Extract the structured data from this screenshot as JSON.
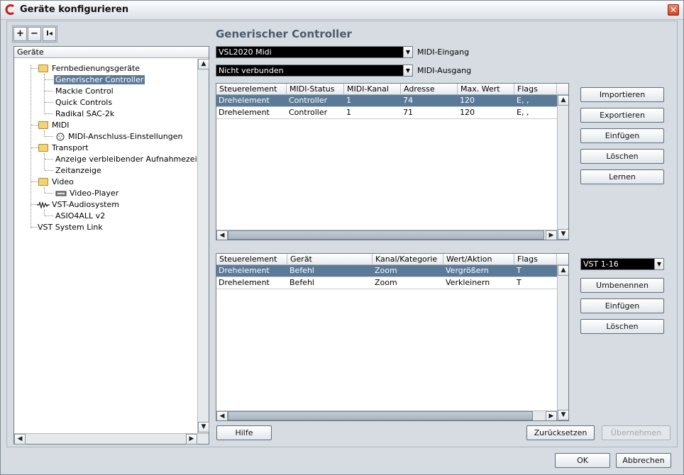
{
  "window": {
    "title": "Geräte konfigurieren",
    "close_label": "✕"
  },
  "toolbar": {
    "add_label": "+",
    "remove_label": "−",
    "reset_label": "I◂"
  },
  "tree": {
    "header": "Geräte",
    "items": [
      {
        "label": "Fernbedienungsgeräte",
        "icon": "folder-icon"
      },
      {
        "label": "Generischer Controller",
        "selected": true
      },
      {
        "label": "Mackie Control"
      },
      {
        "label": "Quick Controls"
      },
      {
        "label": "Radikal SAC-2k"
      },
      {
        "label": "MIDI",
        "icon": "folder-icon"
      },
      {
        "label": "MIDI-Anschluss-Einstellungen",
        "icon": "midi-port-icon"
      },
      {
        "label": "Transport",
        "icon": "folder-icon"
      },
      {
        "label": "Anzeige verbleibender Aufnahmezeit"
      },
      {
        "label": "Zeitanzeige"
      },
      {
        "label": "Video",
        "icon": "folder-icon"
      },
      {
        "label": "Video-Player",
        "icon": "video-icon"
      },
      {
        "label": "VST-Audiosystem",
        "icon": "audio-system-icon"
      },
      {
        "label": "ASIO4ALL v2"
      },
      {
        "label": "VST System Link"
      }
    ]
  },
  "panel": {
    "title": "Generischer Controller",
    "midi_in": {
      "value": "VSL2020 Midi",
      "label": "MIDI-Eingang"
    },
    "midi_out": {
      "value": "Nicht verbunden",
      "label": "MIDI-Ausgang"
    },
    "upper_table": {
      "headers": [
        "Steuerelement",
        "MIDI-Status",
        "MIDI-Kanal",
        "Adresse",
        "Max. Wert",
        "Flags"
      ],
      "rows": [
        [
          "Drehelement",
          "Controller",
          "1",
          "74",
          "120",
          "E, ,"
        ],
        [
          "Drehelement",
          "Controller",
          "1",
          "71",
          "120",
          "E, ,"
        ]
      ]
    },
    "upper_buttons": {
      "import": "Importieren",
      "export": "Exportieren",
      "insert": "Einfügen",
      "delete": "Löschen",
      "learn": "Lernen"
    },
    "lower_table": {
      "headers": [
        "Steuerelement",
        "Gerät",
        "Kanal/Kategorie",
        "Wert/Aktion",
        "Flags"
      ],
      "rows": [
        [
          "Drehelement",
          "Befehl",
          "Zoom",
          "Vergrößern",
          "T"
        ],
        [
          "Drehelement",
          "Befehl",
          "Zoom",
          "Verkleinern",
          "T"
        ]
      ]
    },
    "bank": {
      "value": "VST 1-16"
    },
    "lower_buttons": {
      "rename": "Umbenennen",
      "insert": "Einfügen",
      "delete": "Löschen"
    },
    "help": "Hilfe",
    "reset": "Zurücksetzen",
    "apply": "Übernehmen"
  },
  "footer": {
    "ok": "OK",
    "cancel": "Abbrechen"
  }
}
